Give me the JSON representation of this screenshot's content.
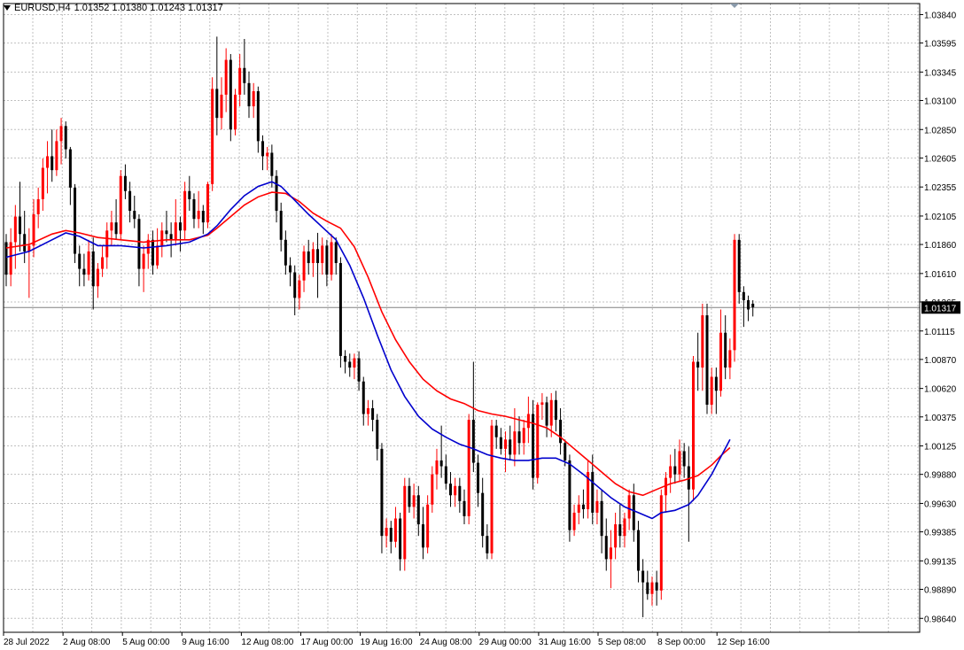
{
  "header": {
    "symbol": "EURUSD,H4",
    "ohlc": "1.01352 1.01380 1.01243 1.01317"
  },
  "chart_data": {
    "type": "candlestick",
    "ylim": [
      0.9852,
      1.03935
    ],
    "y_ticks": [
      "1.03840",
      "1.03595",
      "1.03345",
      "1.03100",
      "1.02850",
      "1.02605",
      "1.02355",
      "1.02105",
      "1.01860",
      "1.01610",
      "1.01365",
      "1.01115",
      "1.00870",
      "1.00620",
      "1.00375",
      "1.00125",
      "0.99880",
      "0.99630",
      "0.99385",
      "0.99135",
      "0.98890",
      "0.98640"
    ],
    "x_ticks": [
      "28 Jul 2022",
      "2 Aug 08:00",
      "5 Aug 00:00",
      "9 Aug 16:00",
      "12 Aug 08:00",
      "17 Aug 00:00",
      "19 Aug 16:00",
      "24 Aug 08:00",
      "29 Aug 00:00",
      "31 Aug 16:00",
      "5 Sep 08:00",
      "8 Sep 00:00",
      "12 Sep 16:00"
    ],
    "current_price": "1.01317",
    "grid": true,
    "colors": {
      "bull": "#ff0000",
      "bear": "#000000",
      "ma_fast": "#0000cd",
      "ma_slow": "#ff0000",
      "grid": "#c0c0c0"
    },
    "candles": [
      [
        1.0188,
        1.0195,
        1.015,
        1.016
      ],
      [
        1.016,
        1.02,
        1.015,
        1.0188
      ],
      [
        1.0188,
        1.022,
        1.0165,
        1.021
      ],
      [
        1.021,
        1.024,
        1.018,
        1.0195
      ],
      [
        1.0195,
        1.0215,
        1.017,
        1.018
      ],
      [
        1.018,
        1.02,
        1.014,
        1.0185
      ],
      [
        1.0185,
        1.0225,
        1.0175,
        1.0212
      ],
      [
        1.0212,
        1.0235,
        1.02,
        1.0225
      ],
      [
        1.0225,
        1.026,
        1.0215,
        1.0252
      ],
      [
        1.0252,
        1.0275,
        1.023,
        1.0262
      ],
      [
        1.0262,
        1.0285,
        1.024,
        1.025
      ],
      [
        1.025,
        1.0285,
        1.0245,
        1.0275
      ],
      [
        1.0275,
        1.0295,
        1.0255,
        1.0288
      ],
      [
        1.0288,
        1.0292,
        1.026,
        1.0268
      ],
      [
        1.0268,
        1.027,
        1.022,
        1.0235
      ],
      [
        1.0235,
        1.0238,
        1.017,
        1.0178
      ],
      [
        1.0178,
        1.0185,
        1.015,
        1.0165
      ],
      [
        1.0165,
        1.0178,
        1.015,
        1.016
      ],
      [
        1.016,
        1.019,
        1.0155,
        1.018
      ],
      [
        1.018,
        1.0192,
        1.013,
        1.015
      ],
      [
        1.015,
        1.017,
        1.014,
        1.0165
      ],
      [
        1.0165,
        1.0185,
        1.0158,
        1.0175
      ],
      [
        1.0175,
        1.0205,
        1.0165,
        1.0198
      ],
      [
        1.0198,
        1.0215,
        1.0185,
        1.0205
      ],
      [
        1.0205,
        1.0225,
        1.019,
        1.0195
      ],
      [
        1.0195,
        1.025,
        1.019,
        1.0245
      ],
      [
        1.0245,
        1.0255,
        1.0225,
        1.0232
      ],
      [
        1.0232,
        1.024,
        1.0205,
        1.0215
      ],
      [
        1.0215,
        1.0228,
        1.02,
        1.0208
      ],
      [
        1.0208,
        1.0212,
        1.015,
        1.0165
      ],
      [
        1.0165,
        1.0185,
        1.0145,
        1.0178
      ],
      [
        1.0178,
        1.0195,
        1.0165,
        1.019
      ],
      [
        1.019,
        1.0198,
        1.016,
        1.0168
      ],
      [
        1.0168,
        1.02,
        1.0165,
        1.0185
      ],
      [
        1.0185,
        1.0205,
        1.0175,
        1.0198
      ],
      [
        1.0198,
        1.0215,
        1.0188,
        1.0195
      ],
      [
        1.0195,
        1.0205,
        1.0175,
        1.019
      ],
      [
        1.019,
        1.0225,
        1.0185,
        1.0205
      ],
      [
        1.0205,
        1.021,
        1.018,
        1.0198
      ],
      [
        1.0198,
        1.024,
        1.019,
        1.0232
      ],
      [
        1.0232,
        1.0245,
        1.0215,
        1.0225
      ],
      [
        1.0225,
        1.023,
        1.02,
        1.0208
      ],
      [
        1.0208,
        1.0232,
        1.02,
        1.0215
      ],
      [
        1.0215,
        1.022,
        1.0195,
        1.0205
      ],
      [
        1.0205,
        1.024,
        1.02,
        1.0238
      ],
      [
        1.0238,
        1.033,
        1.0232,
        1.032
      ],
      [
        1.032,
        1.0365,
        1.028,
        1.0295
      ],
      [
        1.0295,
        1.033,
        1.0285,
        1.0315
      ],
      [
        1.0315,
        1.0355,
        1.03,
        1.0345
      ],
      [
        1.0345,
        1.035,
        1.0275,
        1.0285
      ],
      [
        1.0285,
        1.032,
        1.028,
        1.0315
      ],
      [
        1.0315,
        1.035,
        1.0305,
        1.0338
      ],
      [
        1.0338,
        1.0363,
        1.0315,
        1.0325
      ],
      [
        1.0325,
        1.0335,
        1.0295,
        1.0305
      ],
      [
        1.0305,
        1.0325,
        1.0295,
        1.0318
      ],
      [
        1.0318,
        1.0322,
        1.0265,
        1.0275
      ],
      [
        1.0275,
        1.028,
        1.025,
        1.0262
      ],
      [
        1.0262,
        1.027,
        1.025,
        1.0265
      ],
      [
        1.0265,
        1.0272,
        1.0235,
        1.0245
      ],
      [
        1.0245,
        1.025,
        1.0205,
        1.0215
      ],
      [
        1.0215,
        1.0222,
        1.018,
        1.019
      ],
      [
        1.019,
        1.0198,
        1.016,
        1.0168
      ],
      [
        1.0168,
        1.0175,
        1.015,
        1.0162
      ],
      [
        1.0162,
        1.0168,
        1.0125,
        1.014
      ],
      [
        1.014,
        1.016,
        1.013,
        1.0155
      ],
      [
        1.0155,
        1.0185,
        1.0145,
        1.018
      ],
      [
        1.018,
        1.019,
        1.016,
        1.017
      ],
      [
        1.017,
        1.0188,
        1.0158,
        1.0182
      ],
      [
        1.0182,
        1.0196,
        1.014,
        1.017
      ],
      [
        1.017,
        1.0192,
        1.016,
        1.0185
      ],
      [
        1.0185,
        1.019,
        1.015,
        1.016
      ],
      [
        1.016,
        1.0195,
        1.0155,
        1.0188
      ],
      [
        1.0188,
        1.0192,
        1.016,
        1.017
      ],
      [
        1.017,
        1.0175,
        1.008,
        1.009
      ],
      [
        1.009,
        1.0095,
        1.0075,
        1.0085
      ],
      [
        1.0085,
        1.0092,
        1.0072,
        1.008
      ],
      [
        1.008,
        1.0092,
        1.007,
        1.0088
      ],
      [
        1.0088,
        1.0094,
        1.006,
        1.0068
      ],
      [
        1.0068,
        1.0072,
        1.003,
        1.004
      ],
      [
        1.004,
        1.0052,
        1.003,
        1.0045
      ],
      [
        1.0045,
        1.0052,
        1.0025,
        1.0035
      ],
      [
        1.0035,
        1.004,
        1.0,
        1.001
      ],
      [
        1.001,
        1.0015,
        0.992,
        0.9935
      ],
      [
        0.9935,
        0.995,
        0.9925,
        0.9942
      ],
      [
        0.9942,
        0.9948,
        0.992,
        0.993
      ],
      [
        0.993,
        0.996,
        0.9925,
        0.995
      ],
      [
        0.995,
        0.9955,
        0.9905,
        0.9915
      ],
      [
        0.9915,
        0.9985,
        0.9905,
        0.9978
      ],
      [
        0.9978,
        0.9985,
        0.9955,
        0.996
      ],
      [
        0.996,
        0.998,
        0.995,
        0.997
      ],
      [
        0.997,
        0.9978,
        0.9935,
        0.9945
      ],
      [
        0.9945,
        0.996,
        0.9915,
        0.9925
      ],
      [
        0.9925,
        0.997,
        0.992,
        0.9962
      ],
      [
        0.9962,
        0.9995,
        0.9955,
        0.9988
      ],
      [
        0.9988,
        1.001,
        0.9975,
        1.0
      ],
      [
        1.0,
        1.003,
        0.9985,
        0.9995
      ],
      [
        0.9995,
        1.0005,
        0.9975,
        0.998
      ],
      [
        0.998,
        0.999,
        0.996,
        0.997
      ],
      [
        0.997,
        0.9985,
        0.996,
        0.9978
      ],
      [
        0.9978,
        0.9985,
        0.9955,
        0.9965
      ],
      [
        0.9965,
        0.9975,
        0.9945,
        0.9952
      ],
      [
        0.9952,
        1.004,
        0.9945,
        1.0035
      ],
      [
        1.0035,
        1.0085,
        0.999,
        0.9998
      ],
      [
        0.9998,
        1.0005,
        0.996,
        0.9972
      ],
      [
        0.9972,
        0.9985,
        0.9925,
        0.9935
      ],
      [
        0.9935,
        0.9945,
        0.9915,
        0.992
      ],
      [
        0.992,
        1.0035,
        0.9915,
        1.003
      ],
      [
        1.003,
        1.0035,
        1.001,
        1.002
      ],
      [
        1.002,
        1.0028,
        1.0005,
        1.001
      ],
      [
        1.001,
        1.0025,
        0.999,
        1.0018
      ],
      [
        1.0018,
        1.003,
        1.0,
        1.0005
      ],
      [
        1.0005,
        1.0045,
        0.9995,
        1.0025
      ],
      [
        1.0025,
        1.0038,
        1.0005,
        1.0015
      ],
      [
        1.0015,
        1.0035,
        1.0005,
        1.0028
      ],
      [
        1.0028,
        1.0055,
        1.0015,
        1.004
      ],
      [
        1.004,
        1.0052,
        0.9975,
        0.9985
      ],
      [
        0.9985,
        1.005,
        0.998,
        1.0048
      ],
      [
        1.0048,
        1.0058,
        1.0035,
        1.005
      ],
      [
        1.005,
        1.0055,
        1.002,
        1.003
      ],
      [
        1.003,
        1.0058,
        1.002,
        1.0052
      ],
      [
        1.0052,
        1.006,
        1.0025,
        1.0035
      ],
      [
        1.0035,
        1.0045,
        1.0005,
        1.0015
      ],
      [
        1.0015,
        1.0018,
        0.9995,
        1.0
      ],
      [
        1.0,
        1.0005,
        0.993,
        0.994
      ],
      [
        0.994,
        0.9962,
        0.9935,
        0.9955
      ],
      [
        0.9955,
        0.997,
        0.9945,
        0.9962
      ],
      [
        0.9962,
        0.9975,
        0.995,
        0.9958
      ],
      [
        0.9958,
        1.0,
        0.995,
        0.999
      ],
      [
        0.999,
        1.0005,
        0.9945,
        0.9955
      ],
      [
        0.9955,
        0.9975,
        0.9945,
        0.9965
      ],
      [
        0.9965,
        0.9975,
        0.992,
        0.9935
      ],
      [
        0.9935,
        0.995,
        0.9905,
        0.9915
      ],
      [
        0.9915,
        0.994,
        0.989,
        0.9925
      ],
      [
        0.9925,
        0.9955,
        0.9915,
        0.9945
      ],
      [
        0.9945,
        0.9962,
        0.9925,
        0.9935
      ],
      [
        0.9935,
        0.9955,
        0.9925,
        0.995
      ],
      [
        0.995,
        0.9975,
        0.994,
        0.997
      ],
      [
        0.997,
        0.998,
        0.993,
        0.994
      ],
      [
        0.994,
        0.9948,
        0.9895,
        0.9905
      ],
      [
        0.9905,
        0.9915,
        0.9865,
        0.9895
      ],
      [
        0.9895,
        0.9905,
        0.988,
        0.9885
      ],
      [
        0.9885,
        0.99,
        0.9875,
        0.9895
      ],
      [
        0.9895,
        0.9905,
        0.9875,
        0.9888
      ],
      [
        0.9888,
        0.9975,
        0.988,
        0.997
      ],
      [
        0.997,
        0.999,
        0.9955,
        0.9985
      ],
      [
        0.9985,
        1.0005,
        0.9972,
        0.9995
      ],
      [
        0.9995,
        1.001,
        0.998,
        0.9988
      ],
      [
        0.9988,
        1.0018,
        0.9982,
        1.0008
      ],
      [
        1.0008,
        1.0015,
        0.9985,
        0.9995
      ],
      [
        0.9995,
        1.0012,
        0.993,
        0.9975
      ],
      [
        0.9975,
        1.009,
        0.9965,
        1.0085
      ],
      [
        1.0085,
        1.011,
        1.006,
        1.008
      ],
      [
        1.008,
        1.0135,
        1.006,
        1.0125
      ],
      [
        1.0125,
        1.0135,
        1.004,
        1.0048
      ],
      [
        1.0048,
        1.008,
        1.004,
        1.0072
      ],
      [
        1.0072,
        1.008,
        1.004,
        1.006
      ],
      [
        1.006,
        1.013,
        1.0055,
        1.011
      ],
      [
        1.011,
        1.0125,
        1.007,
        1.008
      ],
      [
        1.008,
        1.0105,
        1.007,
        1.0095
      ],
      [
        1.0095,
        1.0195,
        1.0085,
        1.019
      ],
      [
        1.019,
        1.0195,
        1.0135,
        1.0145
      ],
      [
        1.0145,
        1.015,
        1.0115,
        1.0138
      ],
      [
        1.0138,
        1.0142,
        1.012,
        1.013
      ],
      [
        1.0135,
        1.0138,
        1.0124,
        1.0132
      ]
    ],
    "ma_fast": [
      [
        0,
        1.0175
      ],
      [
        5,
        1.018
      ],
      [
        10,
        1.019
      ],
      [
        13,
        1.0196
      ],
      [
        16,
        1.0193
      ],
      [
        20,
        1.0185
      ],
      [
        25,
        1.0185
      ],
      [
        30,
        1.0183
      ],
      [
        35,
        1.0185
      ],
      [
        40,
        1.0188
      ],
      [
        44,
        1.0195
      ],
      [
        46,
        1.0202
      ],
      [
        49,
        1.0216
      ],
      [
        52,
        1.0228
      ],
      [
        55,
        1.0236
      ],
      [
        58,
        1.024
      ],
      [
        60,
        1.0236
      ],
      [
        63,
        1.0224
      ],
      [
        66,
        1.0212
      ],
      [
        69,
        1.0201
      ],
      [
        72,
        1.019
      ],
      [
        75,
        1.0168
      ],
      [
        78,
        1.014
      ],
      [
        81,
        1.0108
      ],
      [
        84,
        1.0078
      ],
      [
        87,
        1.0055
      ],
      [
        90,
        1.0038
      ],
      [
        93,
        1.0027
      ],
      [
        96,
        1.002
      ],
      [
        99,
        1.0014
      ],
      [
        102,
        1.001
      ],
      [
        105,
        1.0005
      ],
      [
        108,
        1.0002
      ],
      [
        111,
        1.0
      ],
      [
        114,
        1.0
      ],
      [
        117,
        1.0002
      ],
      [
        120,
        1.0002
      ],
      [
        123,
        0.9997
      ],
      [
        126,
        0.9988
      ],
      [
        129,
        0.9978
      ],
      [
        132,
        0.9968
      ],
      [
        135,
        0.996
      ],
      [
        138,
        0.9955
      ],
      [
        141,
        0.995
      ],
      [
        143,
        0.9955
      ],
      [
        146,
        0.9957
      ],
      [
        149,
        0.9962
      ],
      [
        151,
        0.997
      ],
      [
        154,
        0.9988
      ],
      [
        156,
        1.0003
      ],
      [
        158,
        1.0018
      ]
    ],
    "ma_slow": [
      [
        0,
        1.0183
      ],
      [
        5,
        1.0186
      ],
      [
        10,
        1.0195
      ],
      [
        13,
        1.0198
      ],
      [
        16,
        1.0196
      ],
      [
        20,
        1.0192
      ],
      [
        25,
        1.019
      ],
      [
        30,
        1.0188
      ],
      [
        35,
        1.019
      ],
      [
        40,
        1.019
      ],
      [
        44,
        1.0194
      ],
      [
        46,
        1.02
      ],
      [
        49,
        1.021
      ],
      [
        52,
        1.022
      ],
      [
        55,
        1.0227
      ],
      [
        58,
        1.0231
      ],
      [
        61,
        1.023
      ],
      [
        64,
        1.0223
      ],
      [
        67,
        1.0213
      ],
      [
        70,
        1.0206
      ],
      [
        73,
        1.02
      ],
      [
        76,
        1.0184
      ],
      [
        79,
        1.0158
      ],
      [
        82,
        1.0128
      ],
      [
        85,
        1.0104
      ],
      [
        88,
        1.0085
      ],
      [
        91,
        1.007
      ],
      [
        94,
        1.006
      ],
      [
        97,
        1.0053
      ],
      [
        100,
        1.0049
      ],
      [
        103,
        1.0043
      ],
      [
        106,
        1.004
      ],
      [
        109,
        1.0038
      ],
      [
        112,
        1.0035
      ],
      [
        115,
        1.0032
      ],
      [
        118,
        1.0028
      ],
      [
        121,
        1.002
      ],
      [
        124,
        1.001
      ],
      [
        127,
        1.0
      ],
      [
        130,
        0.999
      ],
      [
        133,
        0.998
      ],
      [
        136,
        0.9973
      ],
      [
        139,
        0.997
      ],
      [
        142,
        0.9975
      ],
      [
        145,
        0.998
      ],
      [
        148,
        0.9983
      ],
      [
        151,
        0.9987
      ],
      [
        154,
        0.9996
      ],
      [
        156,
        1.0004
      ],
      [
        158,
        1.0011
      ]
    ]
  }
}
